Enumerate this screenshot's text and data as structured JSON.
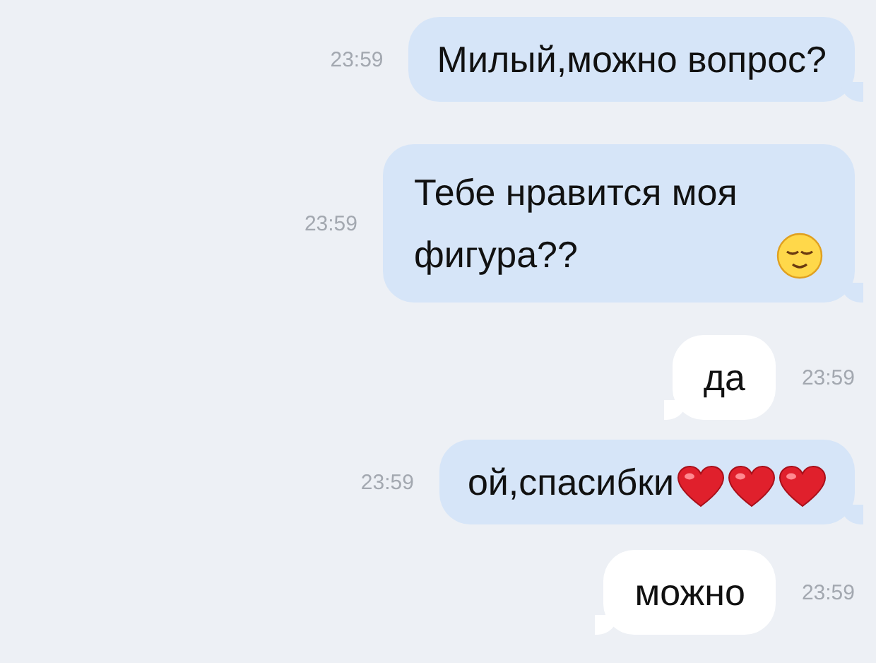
{
  "messages": [
    {
      "kind": "outgoing",
      "text": "Милый,можно вопрос?",
      "time": "23:59"
    },
    {
      "kind": "outgoing",
      "text": "Тебе нравится моя фигура??",
      "time": "23:59",
      "icons": [
        {
          "kind": "smiley"
        }
      ]
    },
    {
      "kind": "incoming",
      "text": "да",
      "time": "23:59"
    },
    {
      "kind": "outgoing",
      "text": "ой,спасибки",
      "time": "23:59",
      "icons": [
        {
          "kind": "heart"
        },
        {
          "kind": "heart"
        },
        {
          "kind": "heart"
        }
      ]
    },
    {
      "kind": "incoming",
      "text": "можно",
      "time": "23:59"
    }
  ]
}
